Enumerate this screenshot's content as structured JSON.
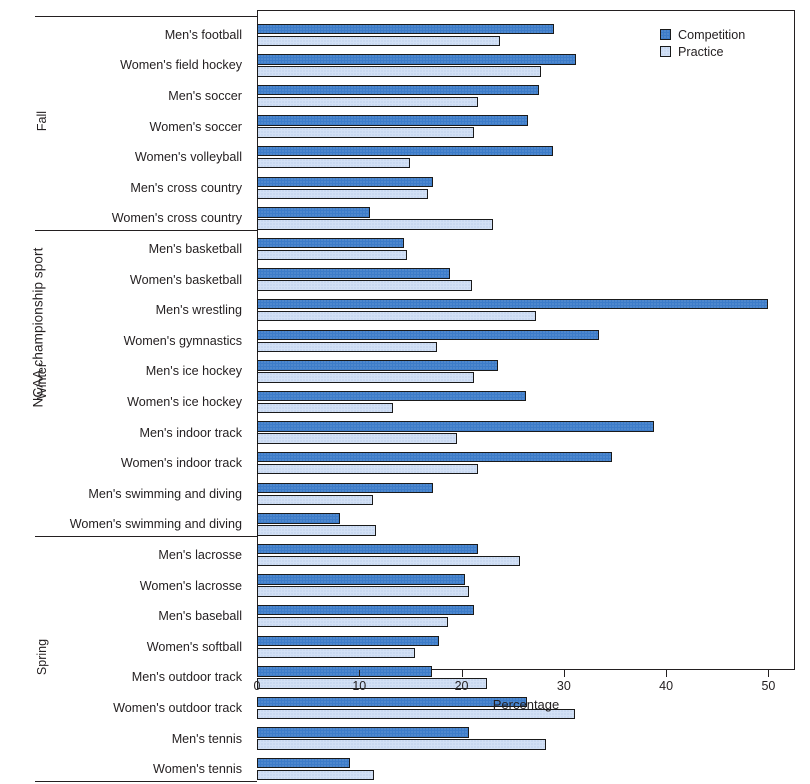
{
  "chart_data": {
    "type": "bar",
    "orientation": "horizontal",
    "title": "",
    "xlabel": "Percentage",
    "ylabel": "NCAA championship sport",
    "xlim": [
      0,
      52.6
    ],
    "xticks": [
      0,
      10,
      20,
      30,
      40,
      50
    ],
    "xtick_labels": [
      "0",
      "10",
      "20",
      "30",
      "40",
      "50"
    ],
    "grid": false,
    "legend_position": "top-right",
    "legend": [
      {
        "name": "Competition",
        "color": "#3d7cc9"
      },
      {
        "name": "Practice",
        "color": "#d2e0f5"
      }
    ],
    "series": [
      {
        "name": "Competition",
        "color": "#3d7cc9"
      },
      {
        "name": "Practice",
        "color": "#d2e0f5"
      }
    ],
    "groups": [
      {
        "label": "Fall",
        "categories": [
          {
            "label": "Men's football",
            "competition": 29.0,
            "practice": 23.8
          },
          {
            "label": "Women's field hockey",
            "competition": 31.2,
            "practice": 27.8
          },
          {
            "label": "Men's soccer",
            "competition": 27.6,
            "practice": 21.6
          },
          {
            "label": "Women's soccer",
            "competition": 26.5,
            "practice": 21.2
          },
          {
            "label": "Women's volleyball",
            "competition": 28.9,
            "practice": 15.0
          },
          {
            "label": "Men's cross country",
            "competition": 17.2,
            "practice": 16.7
          },
          {
            "label": "Women's cross country",
            "competition": 11.0,
            "practice": 23.1
          }
        ]
      },
      {
        "label": "Winter",
        "categories": [
          {
            "label": "Men's basketball",
            "competition": 14.4,
            "practice": 14.7
          },
          {
            "label": "Women's basketball",
            "competition": 18.9,
            "practice": 21.0
          },
          {
            "label": "Men's wrestling",
            "competition": 50.0,
            "practice": 27.3
          },
          {
            "label": "Women's gymnastics",
            "competition": 33.4,
            "practice": 17.6
          },
          {
            "label": "Men's ice hockey",
            "competition": 23.6,
            "practice": 21.2
          },
          {
            "label": "Women's ice hockey",
            "competition": 26.3,
            "practice": 13.3
          },
          {
            "label": "Men's indoor track",
            "competition": 38.8,
            "practice": 19.6
          },
          {
            "label": "Women's indoor track",
            "competition": 34.7,
            "practice": 21.6
          },
          {
            "label": "Men's swimming and diving",
            "competition": 17.2,
            "practice": 11.3
          },
          {
            "label": "Women's swimming and diving",
            "competition": 8.1,
            "practice": 11.6
          }
        ]
      },
      {
        "label": "Spring",
        "categories": [
          {
            "label": "Men's lacrosse",
            "competition": 21.6,
            "practice": 25.7
          },
          {
            "label": "Women's lacrosse",
            "competition": 20.3,
            "practice": 20.7
          },
          {
            "label": "Men's baseball",
            "competition": 21.2,
            "practice": 18.7
          },
          {
            "label": "Women's softball",
            "competition": 17.8,
            "practice": 15.4
          },
          {
            "label": "Men's outdoor track",
            "competition": 17.1,
            "practice": 22.5
          },
          {
            "label": "Women's outdoor track",
            "competition": 26.4,
            "practice": 31.1
          },
          {
            "label": "Men's tennis",
            "competition": 20.7,
            "practice": 28.3
          },
          {
            "label": "Women's tennis",
            "competition": 9.1,
            "practice": 11.4
          }
        ]
      }
    ]
  }
}
